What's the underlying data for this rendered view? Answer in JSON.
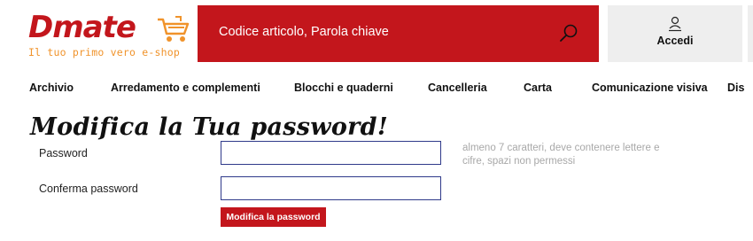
{
  "brand": {
    "logo_text_first": "D",
    "logo_text_rest": "mate",
    "tagline": "Il tuo primo vero e-shop",
    "brand_color": "#c3161c",
    "tagline_color": "#f0932b"
  },
  "search": {
    "placeholder": "Codice articolo, Parola chiave",
    "icon": "search-icon"
  },
  "account": {
    "login_label": "Accedi",
    "icon": "user-icon"
  },
  "nav": {
    "items": [
      "Archivio",
      "Arredamento e complementi",
      "Blocchi e quaderni",
      "Cancelleria",
      "Carta",
      "Comunicazione visiva",
      "Dis"
    ]
  },
  "form": {
    "title": "Modifica la Tua password!",
    "password_label": "Password",
    "password_value": "",
    "confirm_label": "Conferma password",
    "confirm_value": "",
    "hint": "almeno 7 caratteri, deve contenere lettere e cifre, spazi non permessi",
    "submit_label": "Modifica la password"
  }
}
